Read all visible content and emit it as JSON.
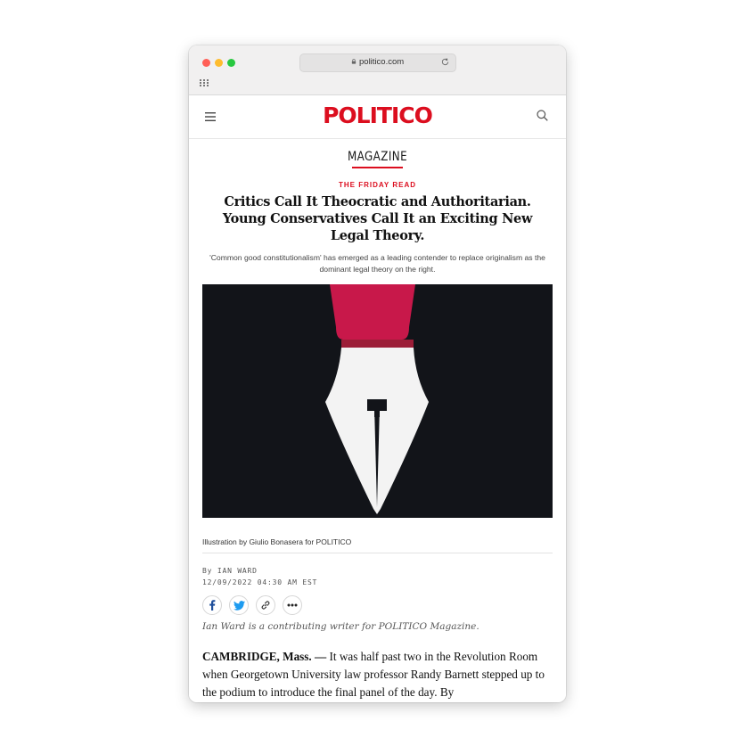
{
  "browser": {
    "url": "politico.com",
    "icons": [
      "close-dot",
      "minimize-dot",
      "zoom-dot",
      "lock-icon",
      "reload-icon",
      "tab-grid-icon"
    ]
  },
  "site": {
    "logo": "POLITICO",
    "icons": [
      "menu-icon",
      "search-icon"
    ],
    "brand_color": "#dc0e1f"
  },
  "article": {
    "section": "MAGAZINE",
    "kicker": "THE FRIDAY READ",
    "headline": "Critics Call It Theocratic and Authoritarian. Young Conservatives Call It an Exciting New Legal Theory.",
    "dek": "'Common good constitutionalism' has emerged as a leading contender to replace originalism as the dominant legal theory on the right.",
    "caption": "Illustration by Giulio Bonasera for POLITICO",
    "byline": "By IAN WARD",
    "timestamp": "12/09/2022 04:30 AM EST",
    "share_icons": [
      "facebook-icon",
      "twitter-icon",
      "link-icon",
      "more-icon"
    ],
    "contributor_note": "Ian Ward is a contributing writer for POLITICO Magazine.",
    "dateline": "CAMBRIDGE, Mass. —",
    "body": " It was half past two in the Revolution Room when Georgetown University law professor Randy Barnett stepped up to the podium to introduce the final panel of the day. By"
  }
}
